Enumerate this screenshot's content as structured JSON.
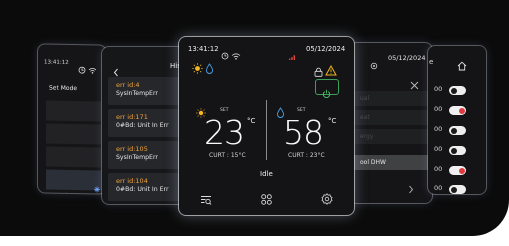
{
  "colors": {
    "accent_green": "#3ba05a",
    "warning": "#f2b21b",
    "error_id": "#f2a23a",
    "toggle_on": "#e03a40"
  },
  "set_mode_screen": {
    "time": "13:41:12",
    "title": "Set Mode"
  },
  "error_screen": {
    "title_partial": "His",
    "errors": [
      {
        "id": "err id:4",
        "message": "SysInTempErr"
      },
      {
        "id": "err id:171",
        "message": "0#Bd: Unit In Err"
      },
      {
        "id": "err id:105",
        "message": "SysInTempErr"
      },
      {
        "id": "err id:104",
        "message": "0#Bd: Unit In Err"
      }
    ]
  },
  "main_screen": {
    "time": "13:41:12",
    "date": "05/12/2024",
    "left_zone": {
      "set_label": "SET",
      "temperature": "23",
      "unit": "°C",
      "current": "CURT : 15°C"
    },
    "right_zone": {
      "set_label": "SET",
      "temperature": "58",
      "unit": "°C",
      "current": "CURT : 23°C"
    },
    "status": "Idle",
    "icons": [
      "clock-icon",
      "wifi-icon",
      "signal-icon",
      "lock-icon",
      "warning-icon",
      "power-icon",
      "sun-icon",
      "water-drop-icon",
      "history-icon",
      "menu-grid-icon",
      "settings-icon"
    ]
  },
  "mode_screen": {
    "date": "05/12/2024",
    "options": [
      "ual",
      "eat",
      "ergy",
      "ool DHW"
    ],
    "selected_option": "ool DHW"
  },
  "toggle_screen": {
    "title_partial": "e",
    "rows": [
      {
        "value": "00",
        "on": false
      },
      {
        "value": "00",
        "on": true
      },
      {
        "value": "00",
        "on": false
      },
      {
        "value": "00",
        "on": false
      },
      {
        "value": "00",
        "on": true
      },
      {
        "value": "00",
        "on": false
      }
    ]
  }
}
